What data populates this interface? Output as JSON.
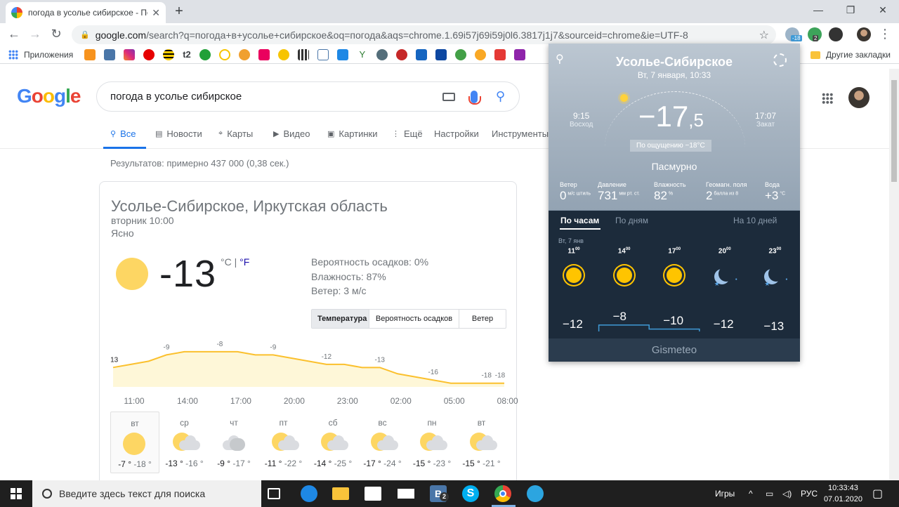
{
  "browser": {
    "tab_title": "погода в усолье сибирское - По",
    "url_host": "google.com",
    "url_rest": "/search?q=погода+в+усолье+сибирское&oq=погода&aqs=chrome.1.69i57j69i59j0l6.3817j1j7&sourceid=chrome&ie=UTF-8",
    "ext_badge_weather": "-18",
    "ext_badge_count": "2",
    "bookmarks_apps": "Приложения",
    "bookmarks_t2": "t2",
    "bookmarks_other": "Другие закладки"
  },
  "google": {
    "logo_letters": [
      "G",
      "o",
      "o",
      "g",
      "l",
      "e"
    ],
    "query": "погода в усолье сибирское",
    "tabs": {
      "all": "Все",
      "news": "Новости",
      "maps": "Карты",
      "video": "Видео",
      "images": "Картинки",
      "more": "Ещё",
      "settings": "Настройки",
      "tools": "Инструменты"
    },
    "results_count": "Результатов: примерно 437 000 (0,38 сек.)"
  },
  "weather_card": {
    "location": "Усолье-Сибирское, Иркутская область",
    "day_time": "вторник 10:00",
    "condition": "Ясно",
    "temperature": "-13",
    "unit_c": "°C",
    "unit_sep": " | ",
    "unit_f": "°F",
    "precip": "Вероятность осадков: 0%",
    "humidity": "Влажность: 87%",
    "wind": "Ветер: 3 м/с",
    "seg_temp": "Температура",
    "seg_precip": "Вероятность осадков",
    "seg_wind": "Ветер",
    "chart_data": {
      "type": "area",
      "x": [
        "11:00",
        "12:00",
        "13:00",
        "14:00",
        "15:00",
        "16:00",
        "17:00",
        "18:00",
        "19:00",
        "20:00",
        "21:00",
        "22:00",
        "23:00",
        "00:00",
        "01:00",
        "02:00",
        "03:00",
        "04:00",
        "05:00",
        "06:00",
        "07:00",
        "08:00",
        "09:00"
      ],
      "values": [
        -13,
        -12,
        -11,
        -9,
        -8,
        -8,
        -8,
        -8,
        -9,
        -9,
        -10,
        -11,
        -12,
        -12,
        -13,
        -13,
        -15,
        -16,
        -17,
        -18,
        -18,
        -18,
        -18
      ],
      "point_labels": [
        {
          "x": "11:00",
          "label": "-13"
        },
        {
          "x": "14:00",
          "label": "-9"
        },
        {
          "x": "17:00",
          "label": "-8"
        },
        {
          "x": "20:00",
          "label": "-9"
        },
        {
          "x": "23:00",
          "label": "-12"
        },
        {
          "x": "02:00",
          "label": "-13"
        },
        {
          "x": "05:00",
          "label": "-16"
        },
        {
          "x": "08:00",
          "label": "-18"
        },
        {
          "x": "09:00",
          "label": "-18"
        }
      ],
      "tick_labels": [
        "11:00",
        "14:00",
        "17:00",
        "20:00",
        "23:00",
        "02:00",
        "05:00",
        "08:00"
      ],
      "ylim": [
        -24,
        -4
      ],
      "line_color": "#fbc02d",
      "fill_color": "#fef7d8"
    },
    "days": [
      {
        "name": "вт",
        "hi": "-7 °",
        "lo": "-18 °",
        "icon": "sun"
      },
      {
        "name": "ср",
        "hi": "-13 °",
        "lo": "-16 °",
        "icon": "sun-cloud"
      },
      {
        "name": "чт",
        "hi": "-9 °",
        "lo": "-17 °",
        "icon": "cloud"
      },
      {
        "name": "пт",
        "hi": "-11 °",
        "lo": "-22 °",
        "icon": "sun-cloud"
      },
      {
        "name": "сб",
        "hi": "-14 °",
        "lo": "-25 °",
        "icon": "sun-cloud"
      },
      {
        "name": "вс",
        "hi": "-17 °",
        "lo": "-24 °",
        "icon": "sun-cloud"
      },
      {
        "name": "пн",
        "hi": "-15 °",
        "lo": "-23 °",
        "icon": "sun-cloud"
      },
      {
        "name": "вт",
        "hi": "-15 °",
        "lo": "-21 °",
        "icon": "sun-cloud"
      }
    ]
  },
  "gismeteo": {
    "city": "Усолье-Сибирское",
    "datetime": "Вт, 7 января, 10:33",
    "sunrise_time": "9:15",
    "sunrise_label": "Восход",
    "sunset_time": "17:07",
    "sunset_label": "Закат",
    "temp_main": "−17",
    "temp_dec": ",5",
    "feels": "По ощущению −18°C",
    "condition": "Пасмурно",
    "params": [
      {
        "label": "Ветер",
        "value": "0",
        "unit": "м/с штиль"
      },
      {
        "label": "Давление",
        "value": "731",
        "unit": "мм рт. ст."
      },
      {
        "label": "Влажность",
        "value": "82",
        "unit": "%"
      },
      {
        "label": "Геомагн. поля",
        "value": "2",
        "unit": "балла из 8"
      },
      {
        "label": "Вода",
        "value": "+3",
        "unit": "°C"
      }
    ],
    "tab_hours": "По часам",
    "tab_days": "По дням",
    "tab_ten": "На 10 дней",
    "day_label": "Вт, 7 янв",
    "hours": [
      {
        "h": "11",
        "m": "00",
        "temp": "−12",
        "icon": "sun"
      },
      {
        "h": "14",
        "m": "00",
        "temp": "−8",
        "icon": "sun"
      },
      {
        "h": "17",
        "m": "00",
        "temp": "−10",
        "icon": "sun"
      },
      {
        "h": "20",
        "m": "00",
        "temp": "−12",
        "icon": "moon"
      },
      {
        "h": "23",
        "m": "00",
        "temp": "−13",
        "icon": "moon"
      }
    ],
    "brand": "Gismeteo",
    "accent": "#3f9ad6"
  },
  "taskbar": {
    "search_placeholder": "Введите здесь текст для поиска",
    "tray_games": "Игры",
    "tray_lang": "РУС",
    "time": "10:33:43",
    "date": "07.01.2020",
    "vk_badge": "2"
  }
}
